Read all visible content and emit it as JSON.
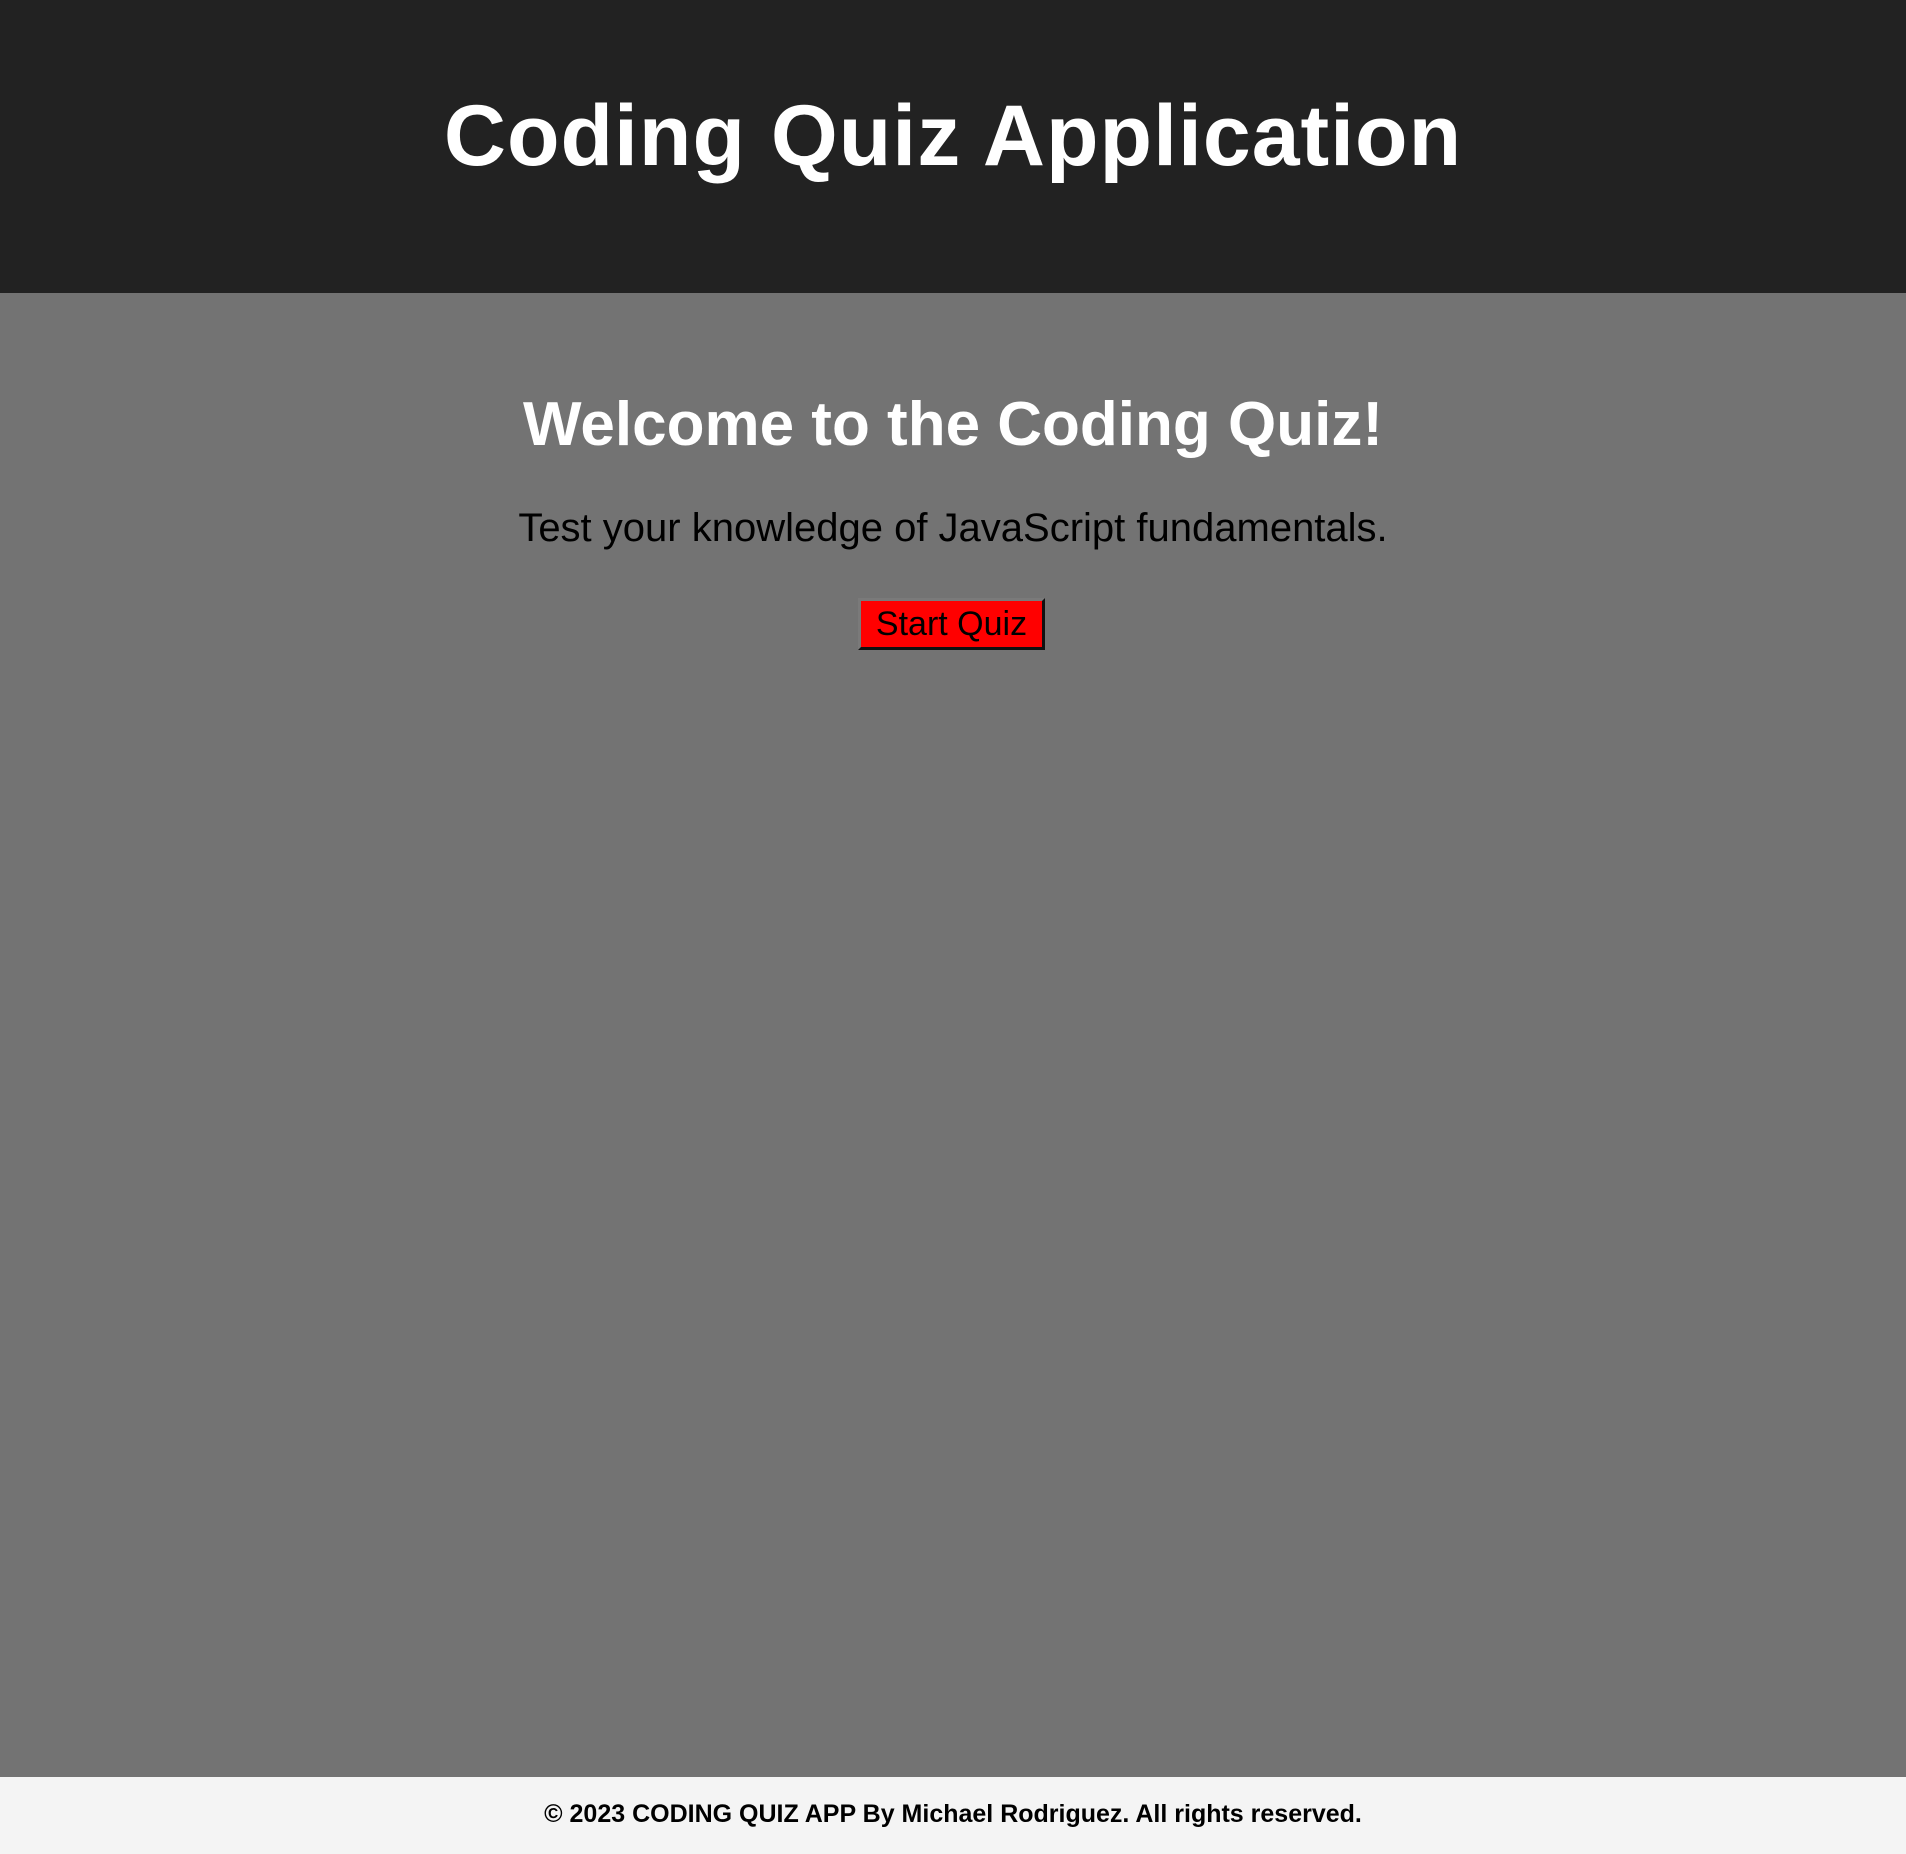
{
  "header": {
    "title": "Coding Quiz Application"
  },
  "main": {
    "heading": "Welcome to the Coding Quiz!",
    "subtitle": "Test your knowledge of JavaScript fundamentals.",
    "start_button_label": "Start Quiz"
  },
  "footer": {
    "text": "© 2023 CODING QUIZ APP By Michael Rodriguez. All rights reserved."
  },
  "colors": {
    "header_bg": "#222222",
    "main_bg": "#737373",
    "footer_bg": "#f4f4f4",
    "button_bg": "#ff0000"
  }
}
